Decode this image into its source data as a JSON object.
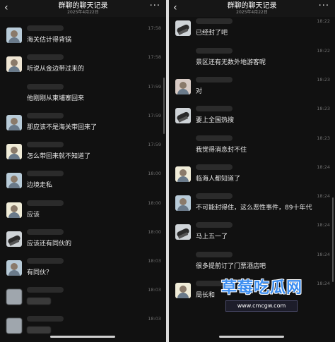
{
  "left": {
    "title": "群聊的聊天记录",
    "date": "2025年4月22日",
    "back_glyph": "‹",
    "more_glyph": "···",
    "messages": [
      {
        "text": "海关估计得背锅",
        "time": "17:58",
        "avatar": "a"
      },
      {
        "text": "听说从金边带过来的",
        "time": "17:58",
        "avatar": "b"
      },
      {
        "text": "他刚刚从柬埔寨回来",
        "time": "17:59",
        "avatar": "none"
      },
      {
        "text": "那应该不是海关带回来了",
        "time": "17:59",
        "avatar": "a"
      },
      {
        "text": "怎么带回来就不知道了",
        "time": "17:59",
        "avatar": "e"
      },
      {
        "text": "边境走私",
        "time": "18:00",
        "avatar": "a"
      },
      {
        "text": "应该",
        "time": "18:00",
        "avatar": "e"
      },
      {
        "text": "应该还有同伙的",
        "time": "18:00",
        "avatar": "c"
      },
      {
        "text": "有同伙？",
        "time": "18:03",
        "avatar": "a"
      },
      {
        "text": "",
        "time": "18:03",
        "avatar": "blur"
      },
      {
        "text": "",
        "time": "18:03",
        "avatar": "blur"
      }
    ]
  },
  "right": {
    "title": "群聊的聊天记录",
    "date": "2025年4月22日",
    "back_glyph": "‹",
    "more_glyph": "···",
    "messages": [
      {
        "text": "已经封了吧",
        "time": "18:22",
        "avatar": "c"
      },
      {
        "text": "景区还有无数外地游客呢",
        "time": "18:22",
        "avatar": "none"
      },
      {
        "text": "对",
        "time": "18:23",
        "avatar": "d"
      },
      {
        "text": "要上全国热搜",
        "time": "18:23",
        "avatar": "c"
      },
      {
        "text": "我觉得消息封不住",
        "time": "18:23",
        "avatar": "none"
      },
      {
        "text": "临海人都知道了",
        "time": "18:24",
        "avatar": "e"
      },
      {
        "text": "不可能封得住，这么恶性事件，89十年代",
        "time": "18:24",
        "avatar": "a"
      },
      {
        "text": "马上五一了",
        "time": "18:24",
        "avatar": "c"
      },
      {
        "text": "很多提前订了门票酒店吧",
        "time": "18:24",
        "avatar": "none"
      },
      {
        "text": "局长和",
        "time": "18:24",
        "avatar": "e"
      }
    ]
  },
  "watermark": {
    "title": "草莓吃瓜网",
    "url": "www.cmcgw.com"
  }
}
